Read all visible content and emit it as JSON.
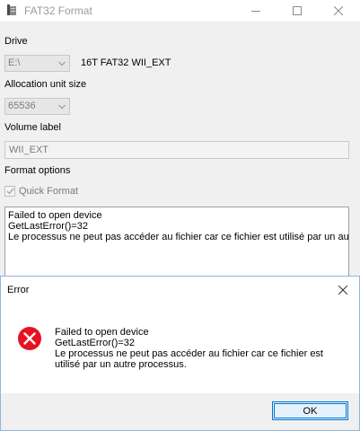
{
  "window": {
    "title": "FAT32 Format"
  },
  "drive": {
    "label": "Drive",
    "selected": "E:\\",
    "description": "16T FAT32 WII_EXT"
  },
  "allocation": {
    "label": "Allocation unit size",
    "selected": "65536"
  },
  "volume": {
    "label": "Volume label",
    "value": "WII_EXT"
  },
  "options": {
    "label": "Format options",
    "quick_format": "Quick Format",
    "quick_format_checked": true
  },
  "log": {
    "lines": [
      "Failed to open device",
      "GetLastError()=32",
      "Le processus ne peut pas accéder au fichier car ce fichier est utilisé par un autr"
    ]
  },
  "error_dialog": {
    "title": "Error",
    "lines": [
      "Failed to open device",
      "GetLastError()=32",
      "Le processus ne peut pas accéder au fichier car ce fichier est",
      "utilisé par un autre processus."
    ],
    "ok_label": "OK",
    "icon": "error-icon"
  },
  "colors": {
    "accent": "#0078d7",
    "error": "#e81123"
  }
}
